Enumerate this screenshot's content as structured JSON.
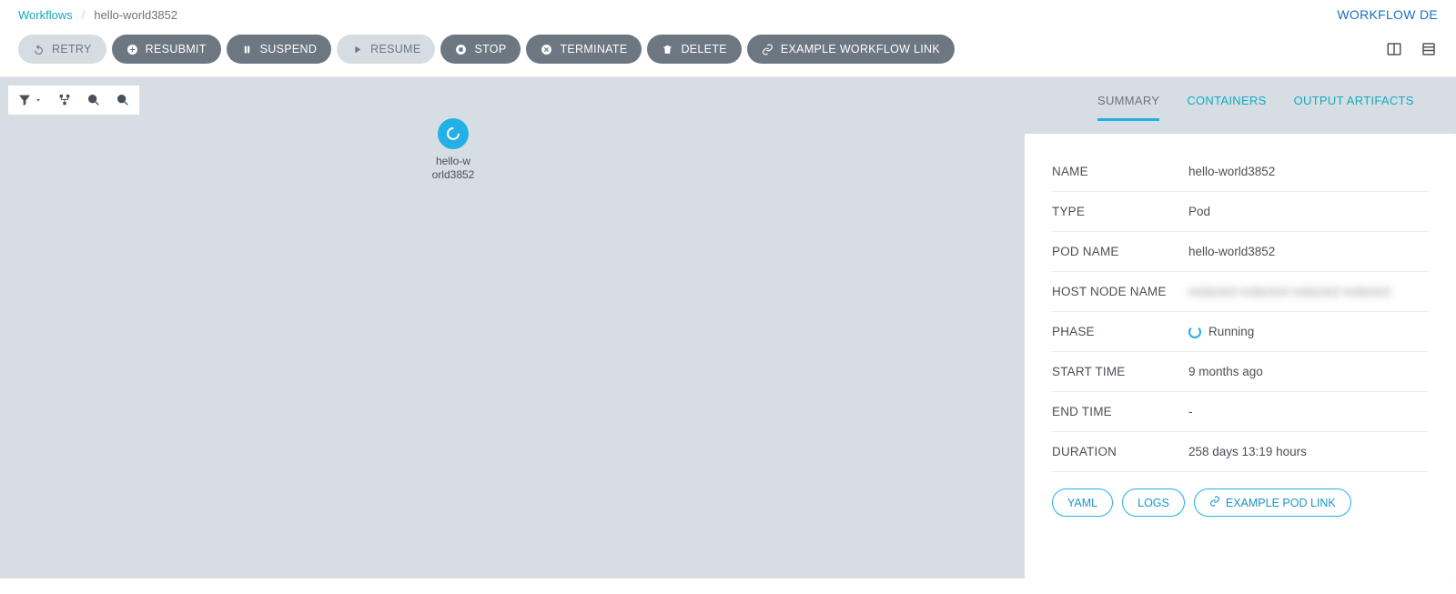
{
  "breadcrumb": {
    "root": "Workflows",
    "current": "hello-world3852"
  },
  "header": {
    "details_label": "WORKFLOW DE"
  },
  "toolbar": {
    "retry": "RETRY",
    "resubmit": "RESUBMIT",
    "suspend": "SUSPEND",
    "resume": "RESUME",
    "stop": "STOP",
    "terminate": "TERMINATE",
    "delete": "DELETE",
    "example_link": "EXAMPLE WORKFLOW LINK"
  },
  "canvas": {
    "node_label_line1": "hello-w",
    "node_label_line2": "orld3852"
  },
  "side_tabs": {
    "summary": "SUMMARY",
    "containers": "CONTAINERS",
    "output_artifacts": "OUTPUT ARTIFACTS"
  },
  "summary": {
    "name_label": "NAME",
    "name_value": "hello-world3852",
    "type_label": "TYPE",
    "type_value": "Pod",
    "pod_name_label": "POD NAME",
    "pod_name_value": "hello-world3852",
    "host_label": "HOST NODE NAME",
    "host_value": "redacted redacted redacted redacted",
    "phase_label": "PHASE",
    "phase_value": "Running",
    "start_label": "START TIME",
    "start_value": "9 months ago",
    "end_label": "END TIME",
    "end_value": "-",
    "duration_label": "DURATION",
    "duration_value": "258 days 13:19 hours"
  },
  "card_buttons": {
    "yaml": "YAML",
    "logs": "LOGS",
    "example_pod": "EXAMPLE POD LINK"
  }
}
